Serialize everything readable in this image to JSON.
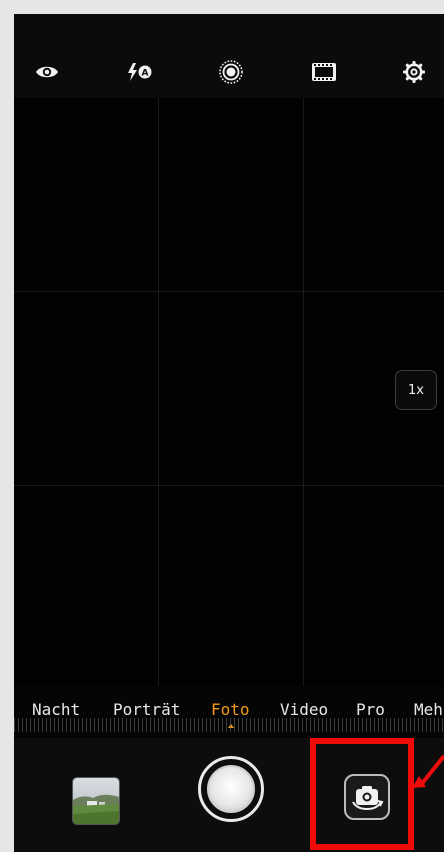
{
  "top_bar": {
    "icons": [
      "eye-icon",
      "flash-auto-icon",
      "live-photo-icon",
      "film-icon",
      "settings-icon"
    ]
  },
  "viewfinder": {
    "zoom_label": "1x"
  },
  "modes": {
    "items": [
      "Nacht",
      "Porträt",
      "Foto",
      "Video",
      "Pro",
      "Meh"
    ],
    "selected": "Foto"
  },
  "bottom_bar": {
    "gallery_thumbnail": "gallery-thumbnail",
    "shutter": "shutter-button",
    "switch_camera": "switch-camera-icon"
  },
  "colors": {
    "accent": "#f29a1a",
    "highlight": "#f00b0b"
  }
}
